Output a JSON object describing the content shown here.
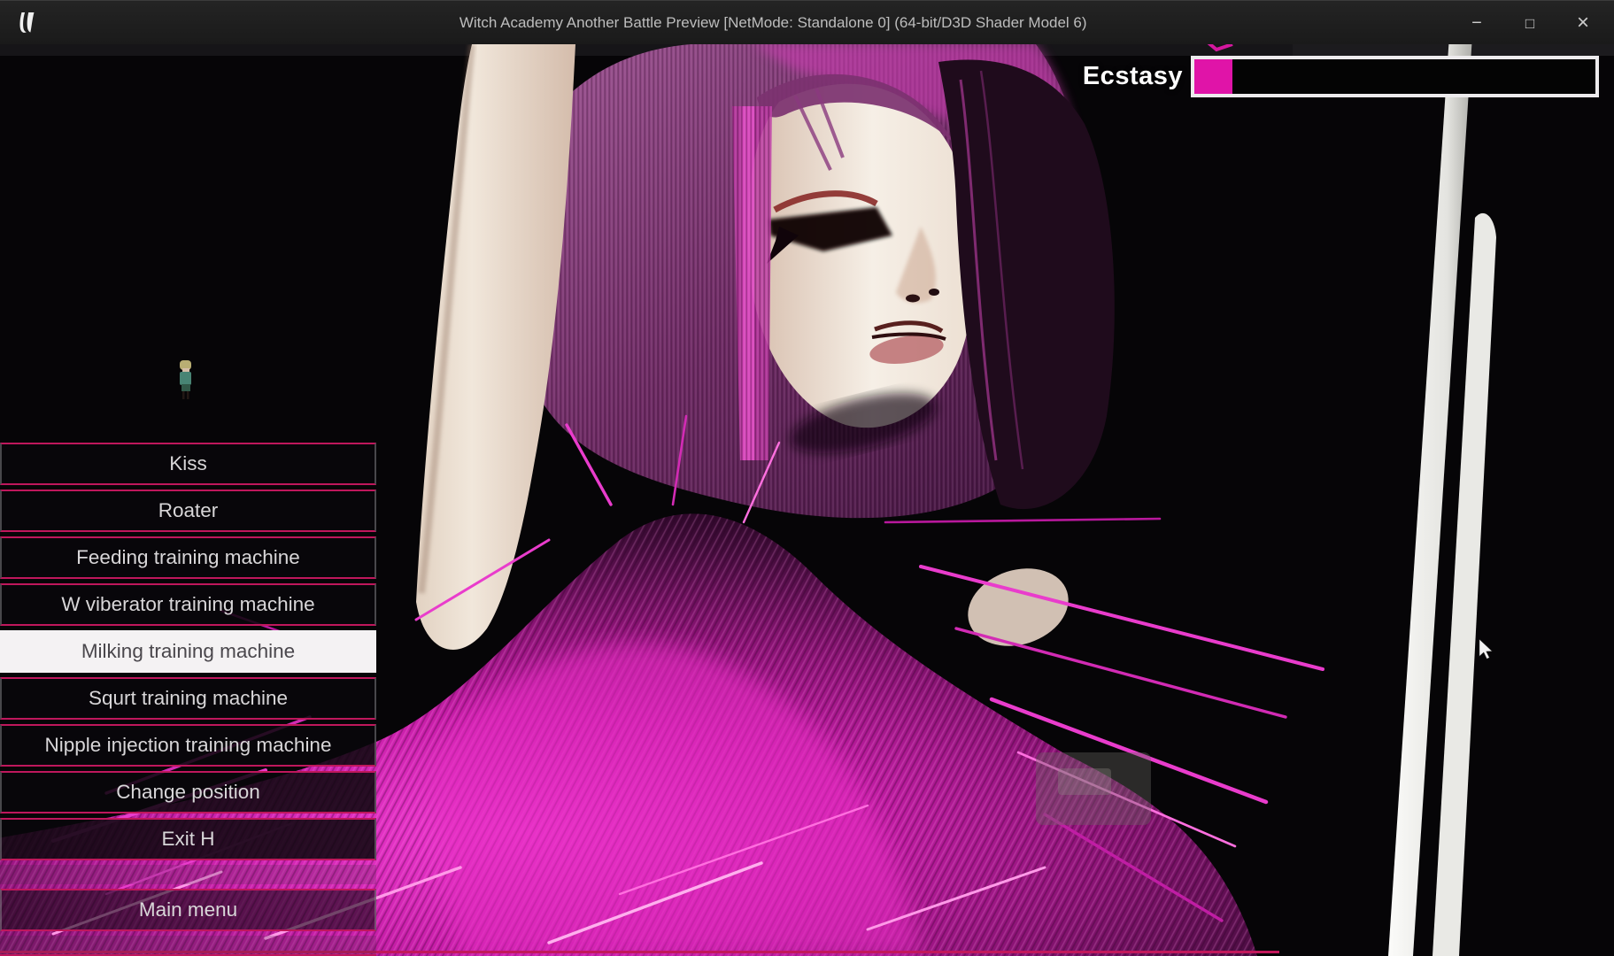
{
  "window": {
    "title": "Witch Academy Another Battle Preview [NetMode: Standalone 0]  (64-bit/D3D Shader Model 6)",
    "controls": {
      "minimize": "−",
      "maximize": "□",
      "close": "×"
    }
  },
  "hud": {
    "ecstasy": {
      "label": "Ecstasy",
      "value_percent": 9.5,
      "fill_color": "#e014a8",
      "border_color": "#edebed"
    }
  },
  "menu": {
    "accent_color": "#bf175c",
    "items": [
      {
        "label": "Kiss",
        "selected": false
      },
      {
        "label": "Roater",
        "selected": false
      },
      {
        "label": "Feeding training machine",
        "selected": false
      },
      {
        "label": "W viberator training machine",
        "selected": false
      },
      {
        "label": "Milking training machine",
        "selected": true
      },
      {
        "label": "Squrt training machine",
        "selected": false
      },
      {
        "label": "Nipple injection training machine",
        "selected": false
      },
      {
        "label": "Change position",
        "selected": false
      },
      {
        "label": "Exit H",
        "selected": false
      }
    ],
    "footer_item": "Main menu"
  },
  "icons": {
    "logo": "unreal-engine-logo-icon",
    "cursor": "mouse-arrow-cursor"
  }
}
